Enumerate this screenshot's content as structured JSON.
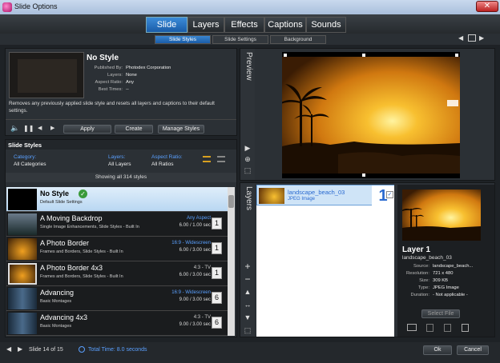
{
  "window": {
    "title": "Slide Options",
    "close_glyph": "✕"
  },
  "main_tabs": [
    {
      "label": "Slide",
      "active": true
    },
    {
      "label": "Layers",
      "active": false
    },
    {
      "label": "Effects",
      "active": false
    },
    {
      "label": "Captions",
      "active": false
    },
    {
      "label": "Sounds",
      "active": false
    }
  ],
  "sub_tabs": [
    {
      "label": "Slide Styles",
      "active": true
    },
    {
      "label": "Slide Settings",
      "active": false
    },
    {
      "label": "Background",
      "active": false
    }
  ],
  "style_info": {
    "name": "No Style",
    "published_by_label": "Published By:",
    "published_by": "Photodex Corporation",
    "layers_label": "Layers:",
    "layers": "None",
    "aspect_label": "Aspect Ratio:",
    "aspect": "Any",
    "best_times_label": "Best Times:",
    "best_times": "--",
    "description": "Removes any previously applied slide style and resets all layers and captions to their default settings."
  },
  "style_buttons": {
    "apply": "Apply",
    "create": "Create",
    "manage": "Manage Styles"
  },
  "slide_styles": {
    "header": "Slide Styles",
    "category_label": "Category:",
    "category_value": "All Categories",
    "layers_label": "Layers:",
    "layers_value": "All Layers",
    "aspect_label": "Aspect Ratio:",
    "aspect_value": "All Ratios",
    "showing": "Showing all 314 styles",
    "items": [
      {
        "name": "No Style",
        "sub": "Default Slide Settings",
        "aspect": "",
        "dur": "",
        "num": "",
        "selected": true
      },
      {
        "name": "A Moving Backdrop",
        "sub": "Single Image Enhancements, Slide Styles - Built In",
        "aspect": "Any Aspect",
        "dur": "6.00 / 1.00 sec",
        "num": "1",
        "selected": false
      },
      {
        "name": "A Photo Border",
        "sub": "Frames and Borders, Slide Styles - Built In",
        "aspect": "16:9 - Widescreen",
        "dur": "6.00 / 3.00 sec",
        "num": "1",
        "selected": false
      },
      {
        "name": "A Photo Border 4x3",
        "sub": "Frames and Borders, Slide Styles - Built In",
        "aspect": "4:3 - TV",
        "dur": "6.00 / 3.00 sec",
        "num": "1",
        "selected": false
      },
      {
        "name": "Advancing",
        "sub": "Basic Montages",
        "aspect": "16:9 - Widescreen",
        "dur": "9.00 / 3.00 sec",
        "num": "6",
        "selected": false
      },
      {
        "name": "Advancing 4x3",
        "sub": "Basic Montages",
        "aspect": "4:3 - TV",
        "dur": "9.00 / 3.00 sec",
        "num": "6",
        "selected": false
      }
    ]
  },
  "preview": {
    "label": "Preview"
  },
  "layers": {
    "label": "Layers",
    "item_name": "landscape_beach_03",
    "item_type": "JPEG Image",
    "item_num": "1",
    "detail_title": "Layer 1",
    "detail_file": "landscape_beach_03",
    "source_label": "Source:",
    "source": "landscape_beach...",
    "resolution_label": "Resolution:",
    "resolution": "721 x 480",
    "size_label": "Size:",
    "size": "309 KB",
    "type_label": "Type:",
    "type": "JPEG Image",
    "duration_label": "Duration:",
    "duration": "- Not applicable -",
    "select_file": "Select File"
  },
  "footer": {
    "slide_info": "Slide 14 of 15",
    "total_time": "Total Time: 8.0 seconds",
    "ok": "Ok",
    "cancel": "Cancel"
  },
  "colors": {
    "accent": "#2a7ad0",
    "selection": "#cfe4f7",
    "sunset_orange": "#e8961c"
  }
}
